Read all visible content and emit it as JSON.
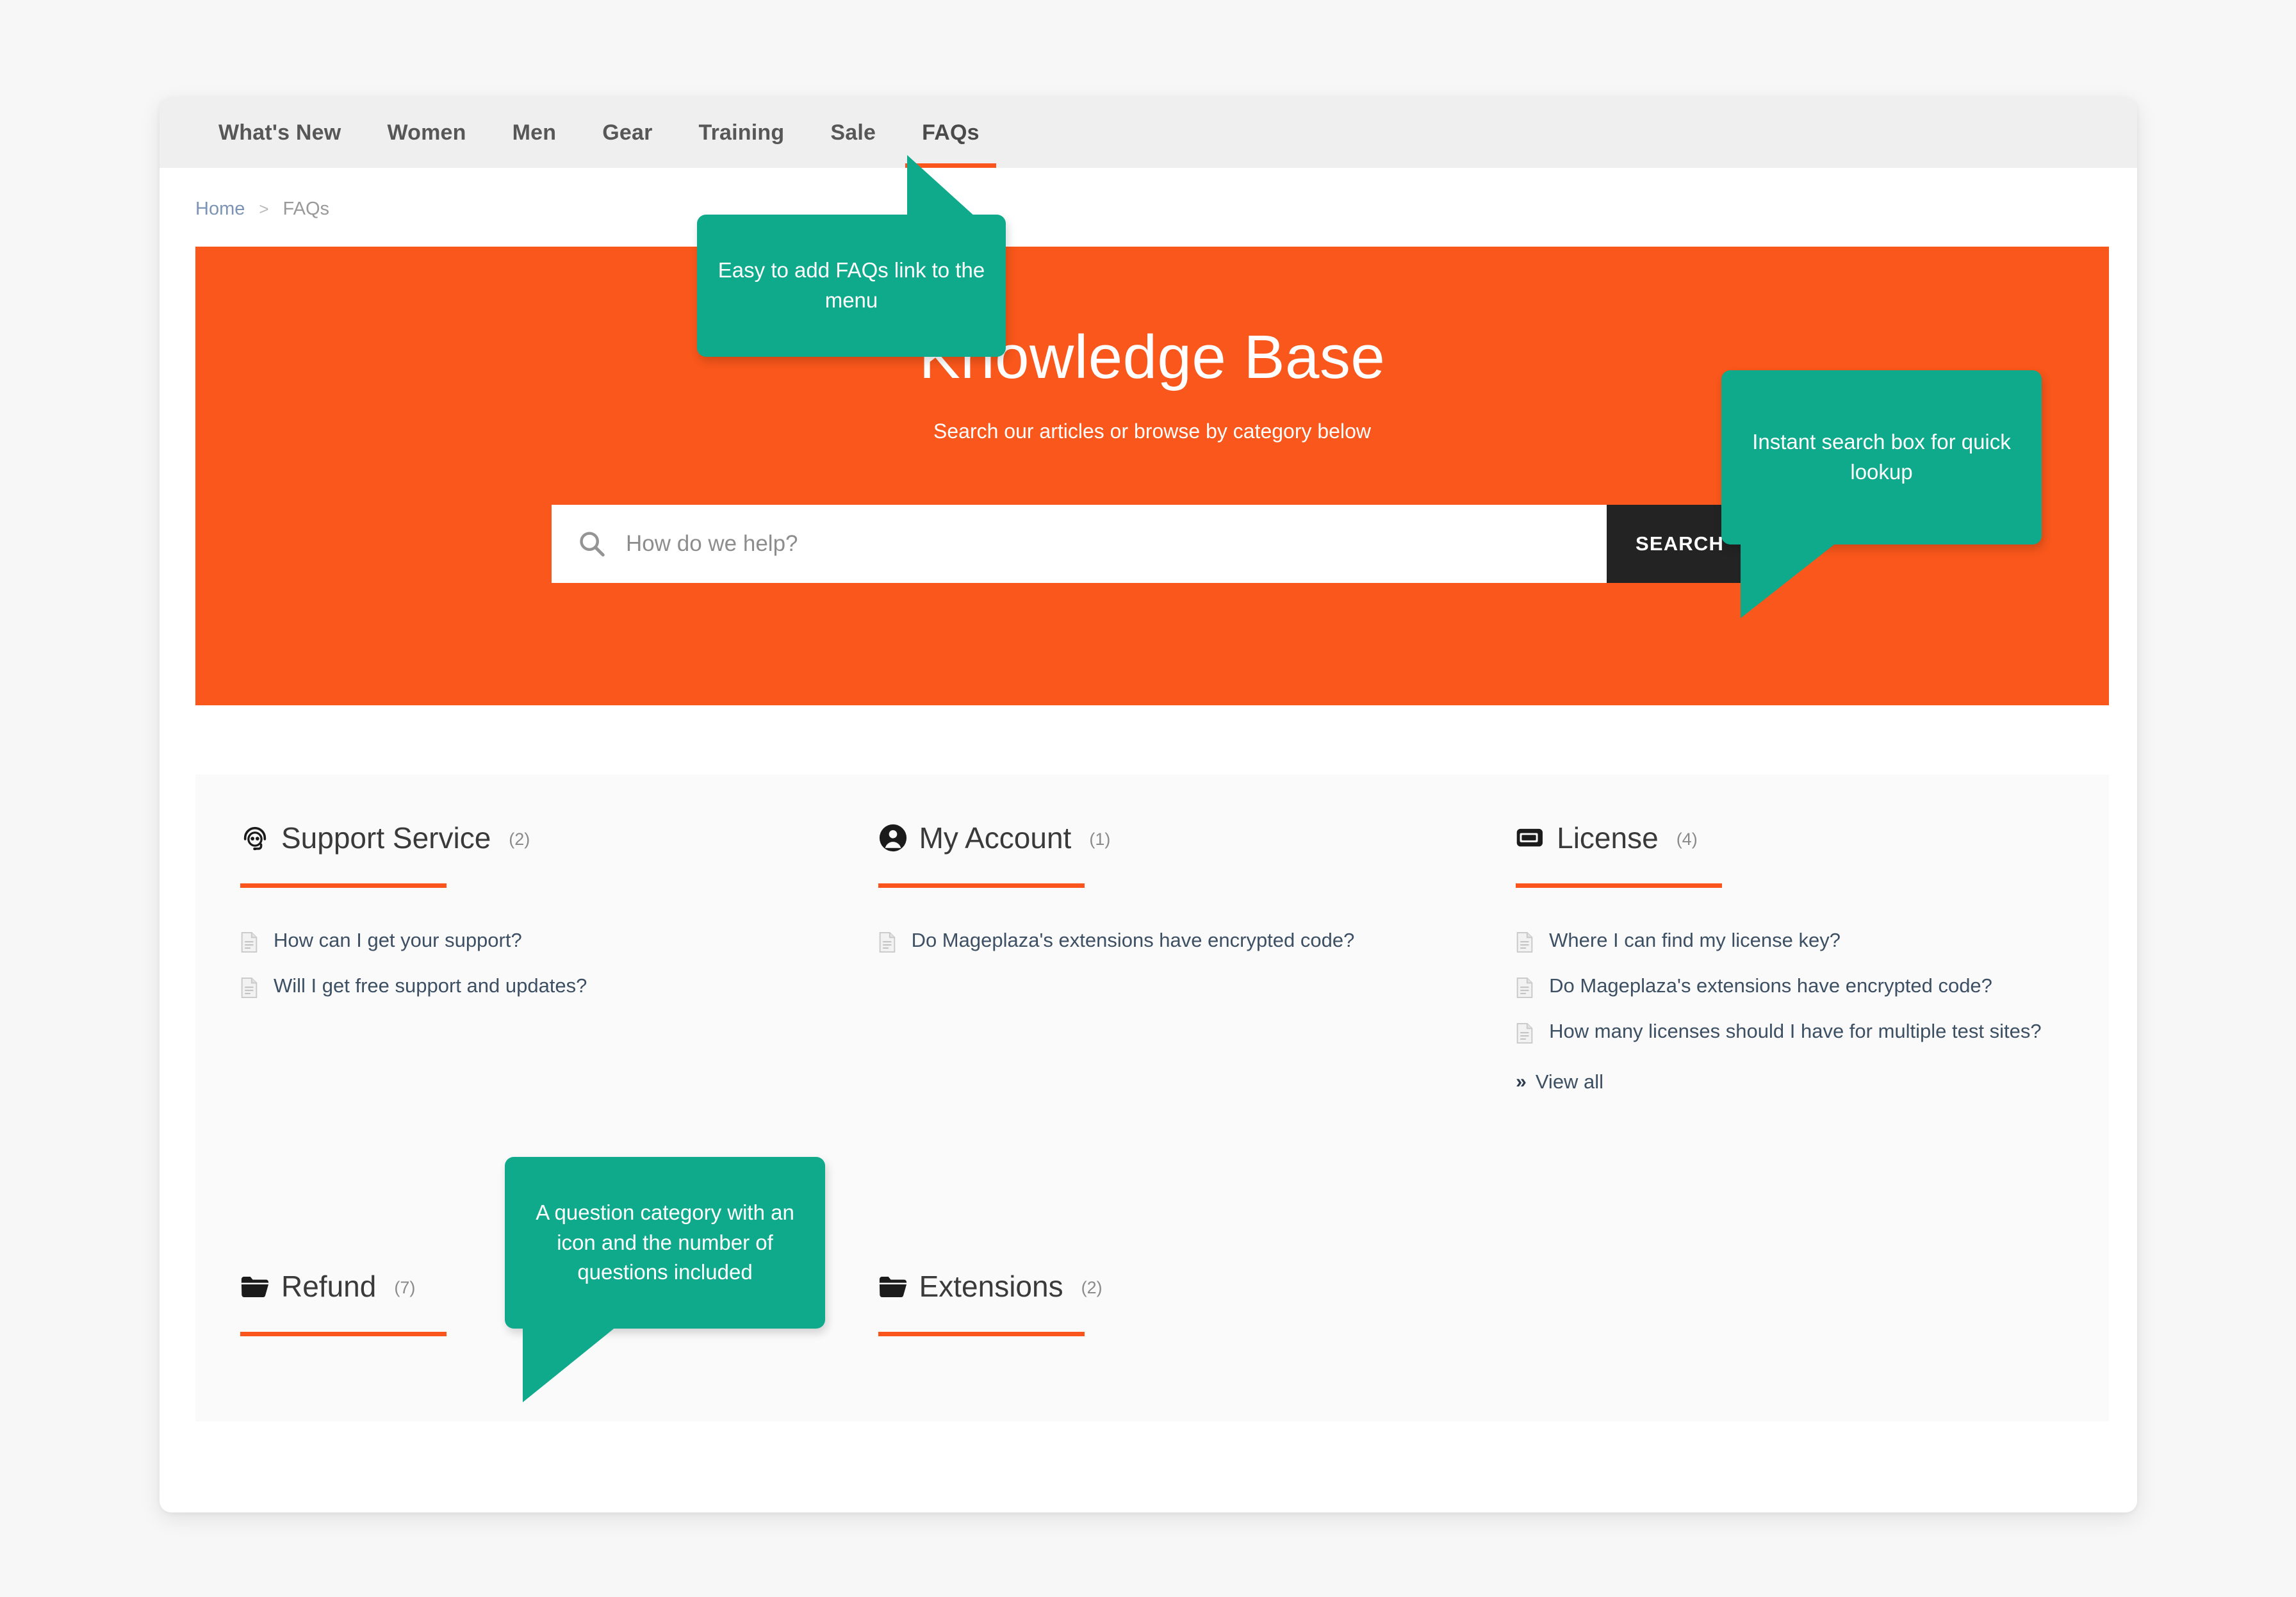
{
  "nav": {
    "items": [
      {
        "label": "What's New",
        "active": false
      },
      {
        "label": "Women",
        "active": false
      },
      {
        "label": "Men",
        "active": false
      },
      {
        "label": "Gear",
        "active": false
      },
      {
        "label": "Training",
        "active": false
      },
      {
        "label": "Sale",
        "active": false
      },
      {
        "label": "FAQs",
        "active": true
      }
    ]
  },
  "breadcrumb": {
    "home": "Home",
    "separator": ">",
    "current": "FAQs"
  },
  "hero": {
    "title": "Knowledge Base",
    "subtitle": "Search our articles or browse by category below",
    "search_placeholder": "How do we help?",
    "search_value": "",
    "search_button": "SEARCH",
    "background_color": "#f9571b",
    "button_color": "#232323"
  },
  "categories": [
    {
      "icon": "headset-icon",
      "name": "Support Service",
      "count": "(2)",
      "questions": [
        "How can I get your support?",
        "Will I get free support and updates?"
      ],
      "view_all": null
    },
    {
      "icon": "user-circle-icon",
      "name": "My Account",
      "count": "(1)",
      "questions": [
        "Do Mageplaza's extensions have encrypted code?"
      ],
      "view_all": null
    },
    {
      "icon": "license-card-icon",
      "name": "License",
      "count": "(4)",
      "questions": [
        "Where I can find my license key?",
        "Do Mageplaza's extensions have encrypted code?",
        "How many licenses should I have for multiple test sites?"
      ],
      "view_all": "View all",
      "view_all_chevron": "»"
    },
    {
      "icon": "folder-open-icon",
      "name": "Refund",
      "count": "(7)",
      "questions": [],
      "view_all": null
    },
    {
      "icon": "folder-open-icon",
      "name": "Extensions",
      "count": "(2)",
      "questions": [],
      "view_all": null
    }
  ],
  "callouts": {
    "menu": "Easy to add FAQs link to the menu",
    "search": "Instant search box for quick lookup",
    "category": "A question category with an icon and the number of questions included",
    "color": "#0fa98c"
  }
}
